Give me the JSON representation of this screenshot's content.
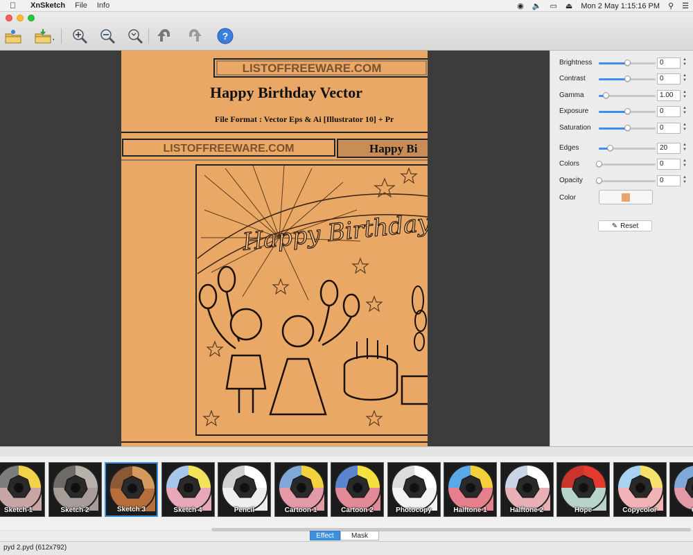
{
  "menubar": {
    "app_name": "XnSketch",
    "menus": [
      "File",
      "Info"
    ],
    "clock": "Mon 2 May  1:15:16 PM"
  },
  "toolbar": {
    "buttons": [
      "open",
      "save",
      "zoom-in",
      "zoom-out",
      "zoom-fit",
      "rotate-left",
      "rotate-right",
      "help"
    ]
  },
  "document": {
    "header_site": "LISTOFFREEWARE.COM",
    "header_title": "Happy Birthday Vector",
    "header_format": "File Format : Vector Eps & Ai [Illustrator 10] + Pr",
    "banner_left": "LISTOFFREEWARE.COM",
    "banner_right": "Happy Bi",
    "card_text": "Happy Birthday",
    "paper_color": "#e9a865"
  },
  "params": [
    {
      "label": "Brightness",
      "value": "0",
      "level": 0.5
    },
    {
      "label": "Contrast",
      "value": "0",
      "level": 0.5
    },
    {
      "label": "Gamma",
      "value": "1.00",
      "level": 0.12
    },
    {
      "label": "Exposure",
      "value": "0",
      "level": 0.5
    },
    {
      "label": "Saturation",
      "value": "0",
      "level": 0.5
    },
    {
      "label": "Edges",
      "value": "20",
      "level": 0.2
    },
    {
      "label": "Colors",
      "value": "0",
      "level": 0.0
    },
    {
      "label": "Opacity",
      "value": "0",
      "level": 0.0
    }
  ],
  "color": {
    "label": "Color",
    "value": "#e8a66e"
  },
  "reset_label": "Reset",
  "effects": [
    {
      "label": "Sketch 1",
      "colors": [
        "#f1d24a",
        "#c9a6a6",
        "#7c7c7c"
      ],
      "selected": false
    },
    {
      "label": "Sketch 2",
      "colors": [
        "#b7b1aa",
        "#a79d98",
        "#6e6a66"
      ],
      "selected": false
    },
    {
      "label": "Sketch 3",
      "colors": [
        "#d79a5e",
        "#b66f3a",
        "#8a5a36"
      ],
      "selected": true
    },
    {
      "label": "Sketch 4",
      "colors": [
        "#f2e35a",
        "#e7a9b6",
        "#a7c6ea"
      ],
      "selected": false
    },
    {
      "label": "Pencil",
      "colors": [
        "#ffffff",
        "#eeeeee",
        "#d0d0d0"
      ],
      "selected": false
    },
    {
      "label": "Cartoon 1",
      "colors": [
        "#f2d33e",
        "#e39aa7",
        "#7fa8d8"
      ],
      "selected": false
    },
    {
      "label": "Cartoon 2",
      "colors": [
        "#f4e13d",
        "#e38a98",
        "#5b86cf"
      ],
      "selected": false
    },
    {
      "label": "Photocopy",
      "colors": [
        "#ffffff",
        "#f2f2f2",
        "#dcdcdc"
      ],
      "selected": false
    },
    {
      "label": "Halftone 1",
      "colors": [
        "#f4d03a",
        "#e57f8b",
        "#5aa9e6"
      ],
      "selected": false
    },
    {
      "label": "Halftone 2",
      "colors": [
        "#ffffff",
        "#e9b0b8",
        "#c9d4e6"
      ],
      "selected": false
    },
    {
      "label": "Hope",
      "colors": [
        "#e23a2e",
        "#b8d3c8",
        "#c9342b"
      ],
      "selected": false
    },
    {
      "label": "Copycolor",
      "colors": [
        "#f6e16c",
        "#f1b3b6",
        "#a7d3f0"
      ],
      "selected": false
    },
    {
      "label": "Cu",
      "colors": [
        "#f2d33e",
        "#e39aa7",
        "#7fa8d8"
      ],
      "selected": false
    }
  ],
  "tabs": {
    "effect": "Effect",
    "mask": "Mask"
  },
  "status": "pyd 2.pyd (612x792)"
}
